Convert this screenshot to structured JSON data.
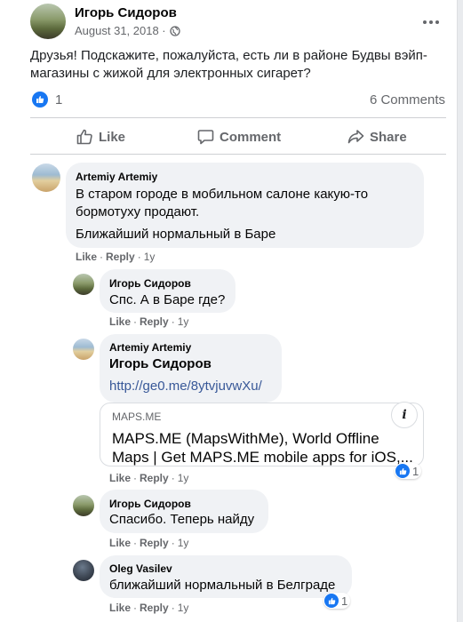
{
  "post": {
    "author": "Игорь Сидоров",
    "date": "August 31, 2018 ·",
    "text": "Друзья! Подскажите, пожалуйста, есть ли в районе Будвы вэйп-магазины с жижой для электронных сигарет?",
    "likes_count": "1",
    "comments_count": "6 Comments",
    "more_icon": "ellipsis-icon",
    "privacy_icon": "globe-icon"
  },
  "actions": {
    "like": "Like",
    "comment": "Comment",
    "share": "Share"
  },
  "colors": {
    "accent": "#1877f2",
    "link": "#385898",
    "bubble": "#f0f2f5"
  },
  "comments": [
    {
      "author": "Artemiy Artemiy",
      "paragraphs": [
        "В старом городе в мобильном салоне какую-то бормотуху продают.",
        "Ближайший нормальный в Баре"
      ],
      "like": "Like",
      "reply": "Reply",
      "time": "1y"
    },
    {
      "author": "Игорь Сидоров",
      "text": "Спс. А в Баре где?",
      "like": "Like",
      "reply": "Reply",
      "time": "1y"
    },
    {
      "author": "Artemiy Artemiy",
      "mention": "Игорь Сидоров",
      "link": "http://ge0.me/8ytvjuvwXu/",
      "preview": {
        "domain": "MAPS.ME",
        "title": "MAPS.ME (MapsWithMe), World Offline Maps | Get MAPS.ME mobile apps for iOS,...",
        "info_icon": "info-icon"
      },
      "reactions": "1",
      "like": "Like",
      "reply": "Reply",
      "time": "1y"
    },
    {
      "author": "Игорь Сидоров",
      "text": "Спасибо. Теперь найду",
      "like": "Like",
      "reply": "Reply",
      "time": "1y"
    },
    {
      "author": "Oleg Vasilev",
      "text": "ближайший нормальный в Белграде",
      "reactions": "1",
      "like": "Like",
      "reply": "Reply",
      "time": "1y"
    }
  ]
}
